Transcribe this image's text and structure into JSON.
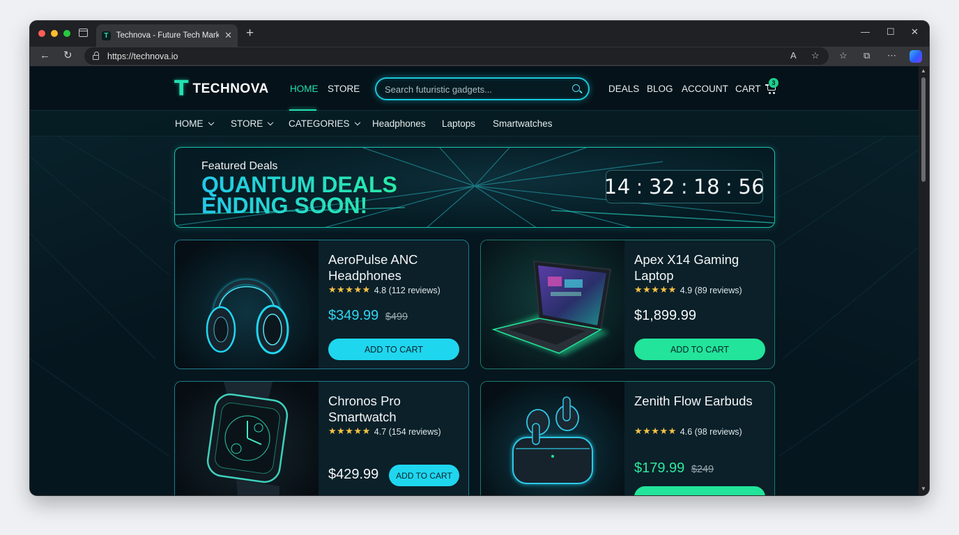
{
  "browser": {
    "tab_title": "Technova - Future Tech Marketplace",
    "tab_favicon": "T",
    "url": "https://technova.io",
    "new_tab_icon": "+",
    "window_controls": [
      "—",
      "☐",
      "✕"
    ]
  },
  "header": {
    "logo_mark": "T",
    "logo_text": "TECHNOVA",
    "nav_left": [
      "HOME",
      "STORE"
    ],
    "active_nav": "HOME",
    "search_placeholder": "Search futuristic gadgets...",
    "nav_right": [
      "DEALS",
      "BLOG",
      "ACCOUNT",
      "CART"
    ],
    "cart_count": "3"
  },
  "subnav": {
    "items": [
      "HOME",
      "STORE",
      "CATEGORIES",
      "Headphones",
      "Laptops",
      "Smartwatches"
    ]
  },
  "banner": {
    "label": "Featured Deals",
    "title": "QUANTUM DEALS ENDING SOON!",
    "countdown": {
      "hours": "14",
      "minutes": "32",
      "seconds": "18",
      "frames": "56",
      "separator": ":"
    }
  },
  "products": [
    {
      "name": "AeroPulse ANC Headphones",
      "stars": "★★★★★",
      "rating": "4.8 (112 reviews)",
      "price": "$349.99",
      "old_price": "$499",
      "cta": "ADD TO CART",
      "accent": "#1fd6ef"
    },
    {
      "name": "Apex X14 Gaming Laptop",
      "stars": "★★★★★",
      "rating": "4.9 (89 reviews)",
      "price": "$1,899.99",
      "old_price": "",
      "cta": "ADD TO CART",
      "accent": "#22e49a"
    },
    {
      "name": "Chronos Pro Smartwatch",
      "stars": "★★★★★",
      "rating": "4.7 (154 reviews)",
      "price": "$429.99",
      "old_price": "",
      "cta": "ADD TO CART",
      "accent": "#1fd6ef"
    },
    {
      "name": "Zenith Flow Earbuds",
      "stars": "★★★★★",
      "rating": "4.6 (98 reviews)",
      "price": "$179.99",
      "old_price": "$249",
      "cta": "",
      "accent": "#22e49a"
    }
  ],
  "colors": {
    "accent_teal": "#23e0b2",
    "accent_cyan": "#1fd6ef",
    "accent_green": "#22e49a",
    "background": "#06161f"
  },
  "icons": [
    "back-arrow-icon",
    "reload-icon",
    "lock-icon",
    "read-aloud-icon",
    "favorite-star-icon",
    "favorites-icon",
    "collections-icon",
    "more-icon",
    "copilot-icon",
    "search-icon",
    "cart-icon",
    "chevron-down-icon"
  ]
}
